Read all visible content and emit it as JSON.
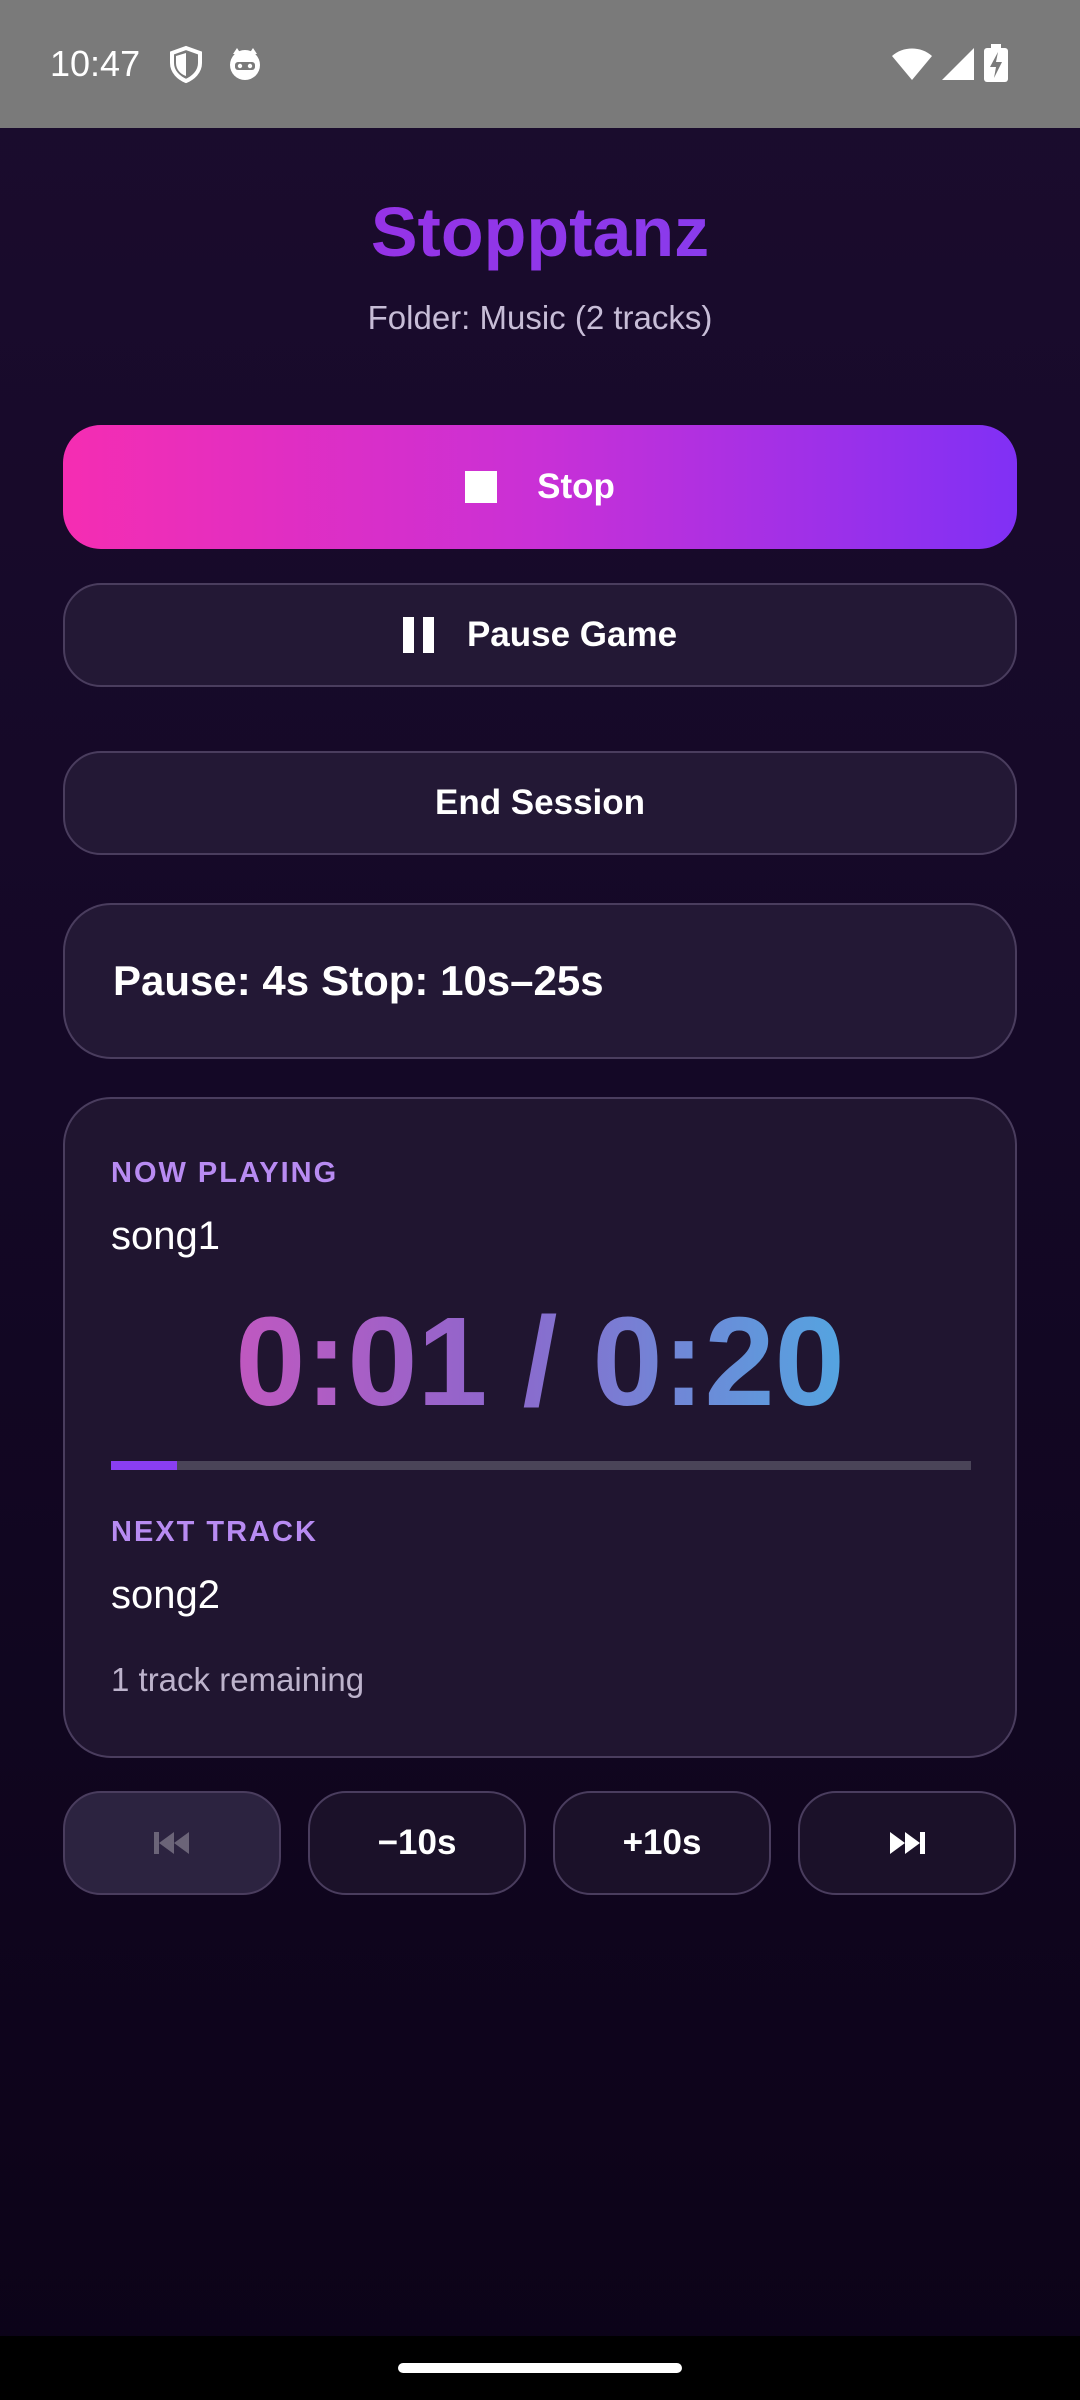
{
  "status_bar": {
    "time": "10:47",
    "icons": [
      "shield-icon",
      "cat-icon",
      "wifi-icon",
      "signal-icon",
      "battery-charging-icon"
    ]
  },
  "header": {
    "title": "Stopptanz",
    "subtitle": "Folder: Music (2 tracks)"
  },
  "actions": {
    "stop_label": "Stop",
    "pause_label": "Pause Game",
    "end_label": "End Session"
  },
  "info": {
    "pause_text": "Pause: 4s",
    "stop_text": "Stop: 10s–25s"
  },
  "now_playing": {
    "label": "NOW PLAYING",
    "track": "song1",
    "time_text": "0:01 / 0:20",
    "progress": 0.077,
    "next_label": "NEXT TRACK",
    "next_track": "song2",
    "remaining": "1 track remaining"
  },
  "controls": {
    "rewind_10": "−10s",
    "forward_10": "+10s",
    "previous_icon": "skip-previous-icon",
    "next_icon": "skip-next-icon"
  },
  "colors": {
    "accent_pink": "#f52db2",
    "accent_purple": "#8030f5",
    "background": "#140826"
  }
}
